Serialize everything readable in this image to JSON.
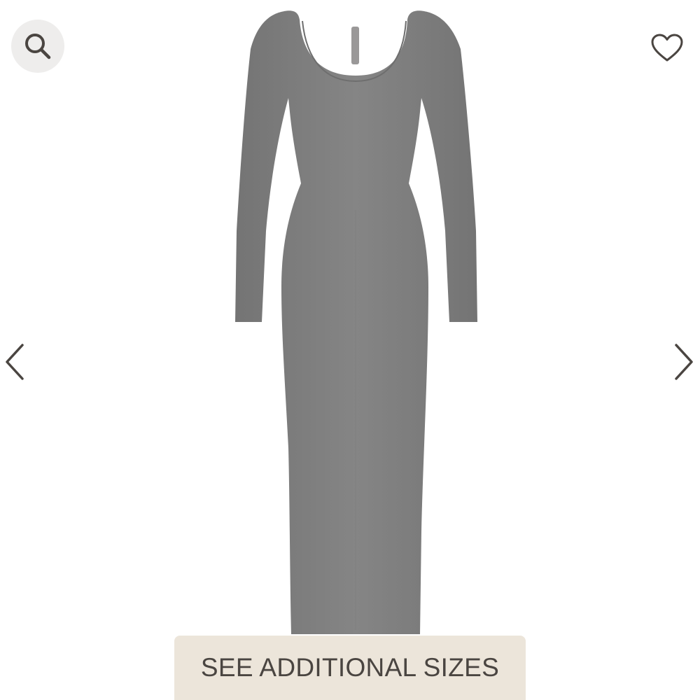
{
  "product": {
    "color_name": "heather grey",
    "dress_color": "#7f7f7f"
  },
  "actions": {
    "search_icon": "search-icon",
    "favorite_icon": "heart-outline-icon",
    "prev_icon": "chevron-left-icon",
    "next_icon": "chevron-right-icon",
    "sizes_label": "SEE ADDITIONAL SIZES"
  },
  "colors": {
    "icon": "#4a4541",
    "search_bg": "#eeedec",
    "sizes_bg": "#ece5da"
  }
}
